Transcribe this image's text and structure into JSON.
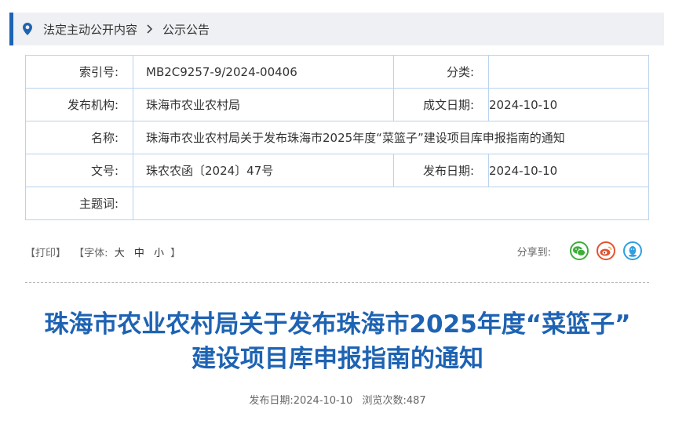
{
  "breadcrumb": {
    "section": "法定主动公开内容",
    "current": "公示公告"
  },
  "meta": {
    "index_label": "索引号:",
    "index_value": "MB2C9257-9/2024-00406",
    "category_label": "分类:",
    "category_value": "",
    "publisher_label": "发布机构:",
    "publisher_value": "珠海市农业农村局",
    "created_label": "成文日期:",
    "created_value": "2024-10-10",
    "name_label": "名称:",
    "name_value": "珠海市农业农村局关于发布珠海市2025年度“菜篮子”建设项目库申报指南的通知",
    "docno_label": "文号:",
    "docno_value": "珠农农函〔2024〕47号",
    "pubdate_label": "发布日期:",
    "pubdate_value": "2024-10-10",
    "subject_label": "主题词:",
    "subject_value": ""
  },
  "tools": {
    "print": "【打印】",
    "font_prefix": "【字体:",
    "large": "大",
    "medium": "中",
    "small": "小",
    "font_suffix": "】"
  },
  "share": {
    "label": "分享到:",
    "icons": [
      "wechat-icon",
      "weibo-icon",
      "qq-icon"
    ],
    "colors": {
      "wechat": "#3dae3a",
      "weibo": "#e6512f",
      "qq": "#2f9fe0"
    }
  },
  "article": {
    "title_line1": "珠海市农业农村局关于发布珠海市2025年度“菜篮子”",
    "title_line2": "建设项目库申报指南的通知",
    "pub_label": "发布日期:",
    "pub_date": "2024-10-10",
    "views_label": "浏览次数:",
    "views": "487"
  },
  "colors": {
    "accent": "#1e63b3",
    "border": "#b9d3ee"
  }
}
